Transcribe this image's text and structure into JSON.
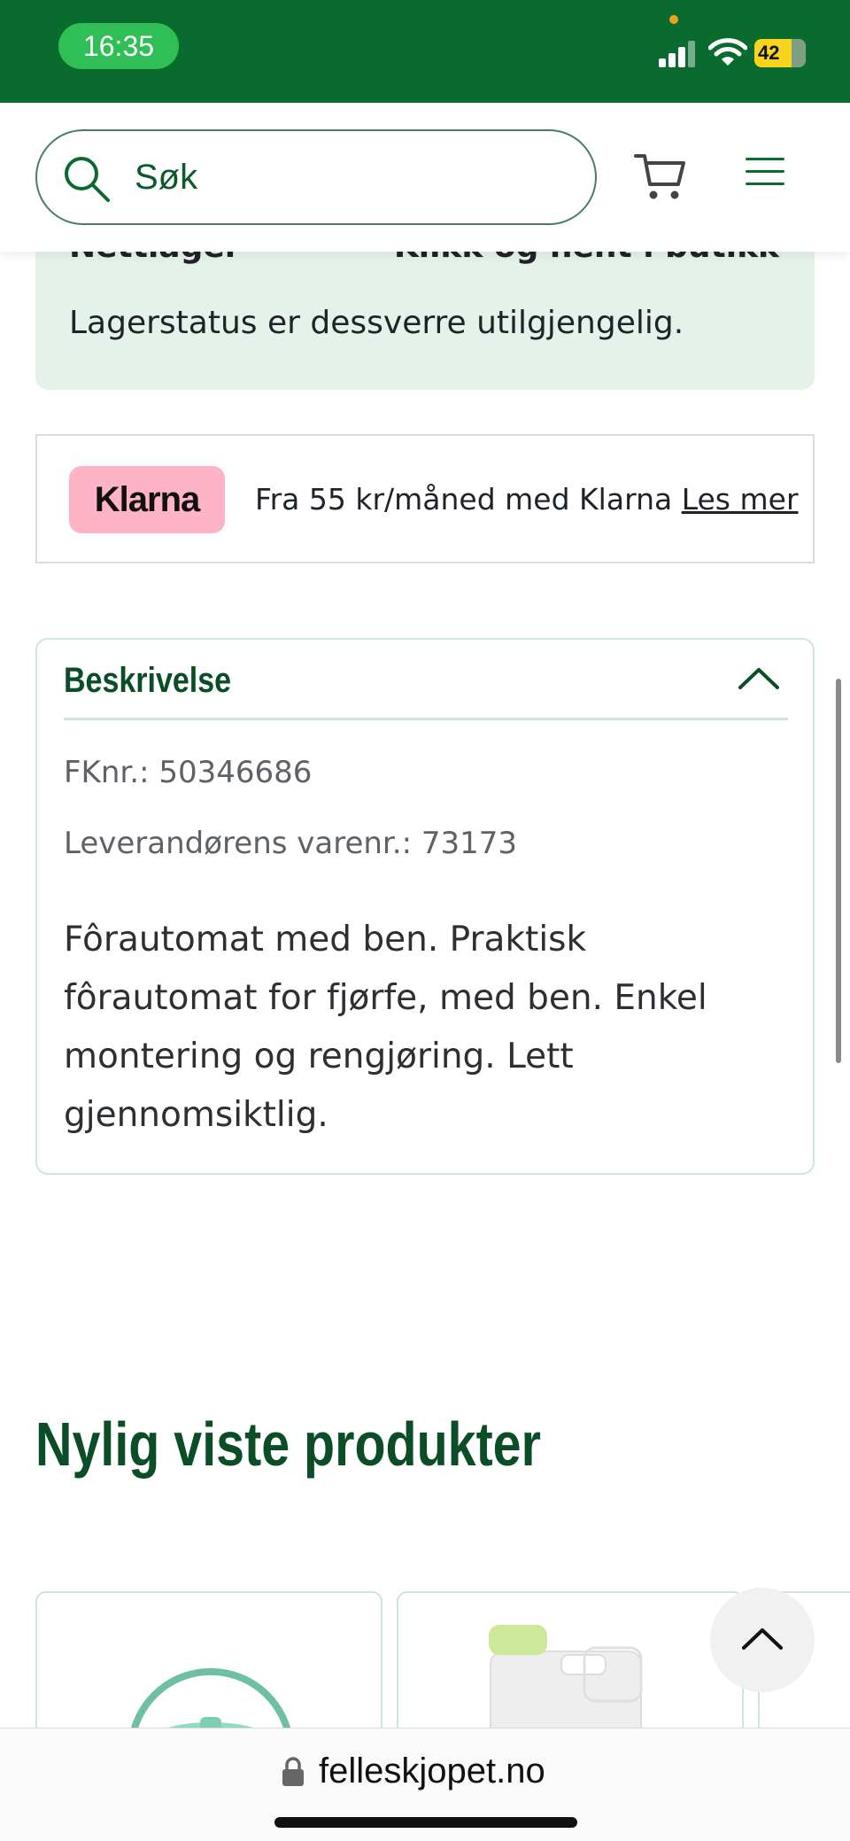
{
  "status_bar": {
    "time": "16:35",
    "battery": "42"
  },
  "header": {
    "search_placeholder": "Søk"
  },
  "stock": {
    "col_left_label": "Nettlager",
    "col_right_label": "Klikk og hent i butikk",
    "status": "Lagerstatus er dessverre utilgjengelig."
  },
  "klarna": {
    "logo": "Klarna",
    "text": "Fra 55 kr/måned med Klarna",
    "link": "Les mer"
  },
  "description": {
    "title": "Beskrivelse",
    "fk_number": "FKnr.: 50346686",
    "supplier_number": "Leverandørens varenr.: 73173",
    "body": "Fôrautomat med ben. Praktisk fôrautomat for fjørfe, med ben. Enkel montering og rengjøring. Lett gjennomsiktlig."
  },
  "recently_viewed": {
    "title": "Nylig viste produkter"
  },
  "browser": {
    "url": "felleskjopet.no"
  },
  "colors": {
    "brand_green": "#0a6b2e",
    "heading_green": "#0a4d26",
    "stock_bg": "#e5f2ea",
    "klarna_pink": "#ffb3c7"
  }
}
